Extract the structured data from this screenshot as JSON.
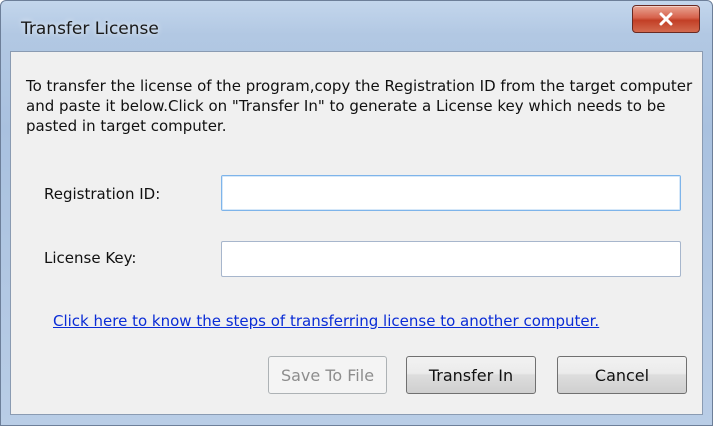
{
  "window": {
    "title": "Transfer License",
    "close_icon": "close-icon"
  },
  "content": {
    "description": "To transfer the license of the program,copy the Registration ID from the target computer and paste it below.Click on \"Transfer In\" to generate a License key which needs to be pasted in target computer.",
    "registration_id": {
      "label": "Registration ID:",
      "value": ""
    },
    "license_key": {
      "label": "License Key:",
      "value": ""
    },
    "help_link": "Click here to know the steps of transferring license to another computer."
  },
  "buttons": {
    "save_to_file": "Save To File",
    "transfer_in": "Transfer In",
    "cancel": "Cancel"
  },
  "colors": {
    "link": "#0a2cd6",
    "close_button": "#c23f26",
    "title_bar": "#b2c8e3"
  }
}
